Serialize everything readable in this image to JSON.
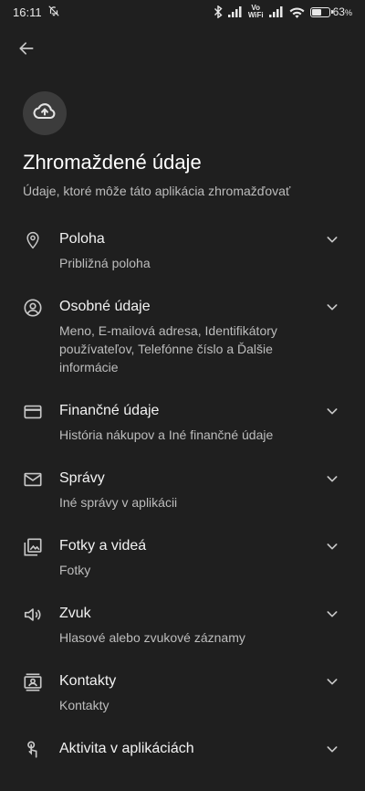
{
  "status_bar": {
    "time": "16:11",
    "vowifi_top": "Vo",
    "vowifi_bottom": "WiFi",
    "battery_percent_text": "63",
    "battery_percent_symbol": "%",
    "battery_level": 0.63
  },
  "header": {
    "title": "Zhromaždené údaje",
    "subtitle": "Údaje, ktoré môže táto aplikácia zhromažďovať"
  },
  "items": [
    {
      "icon": "location-pin-icon",
      "title": "Poloha",
      "desc": "Približná poloha"
    },
    {
      "icon": "account-circle-icon",
      "title": "Osobné údaje",
      "desc": "Meno, E-mailová adresa, Identifikátory používateľov, Telefónne číslo a Ďalšie informácie"
    },
    {
      "icon": "credit-card-icon",
      "title": "Finančné údaje",
      "desc": "História nákupov a Iné finančné údaje"
    },
    {
      "icon": "mail-icon",
      "title": "Správy",
      "desc": "Iné správy v aplikácii"
    },
    {
      "icon": "photo-library-icon",
      "title": "Fotky a videá",
      "desc": "Fotky"
    },
    {
      "icon": "speaker-icon",
      "title": "Zvuk",
      "desc": "Hlasové alebo zvukové záznamy"
    },
    {
      "icon": "contacts-icon",
      "title": "Kontakty",
      "desc": "Kontakty"
    },
    {
      "icon": "touch-app-icon",
      "title": "Aktivita v aplikáciách",
      "desc": ""
    }
  ]
}
